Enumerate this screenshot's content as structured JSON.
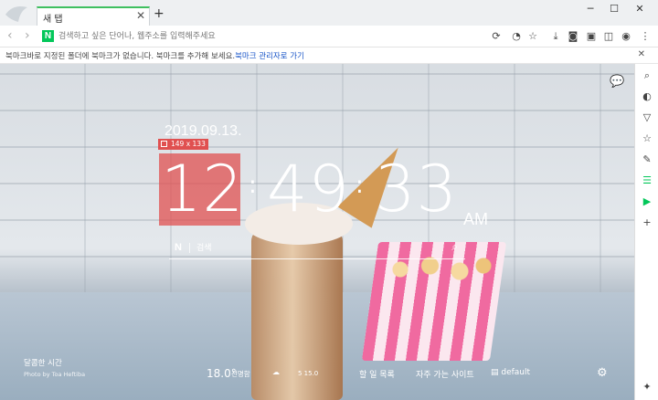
{
  "tab": {
    "title": "새 탭",
    "close": "✕",
    "new": "+"
  },
  "window": {
    "minimize": "─",
    "maximize": "☐",
    "close": "✕"
  },
  "toolbar": {
    "back": "‹",
    "forward": "›",
    "site_badge": "N",
    "address_placeholder": "검색하고 싶은 단어나, 웹주소를 입력해주세요"
  },
  "bookmark_bar": {
    "message": "북마크바로 지정된 폴더에 북마크가 없습니다. 북마크를 추가해 보세요.",
    "manage_link": "북마크 관리자로 가기",
    "close": "✕"
  },
  "overlay": {
    "selection_size": "149 x 133"
  },
  "clock": {
    "date": "2019.09.13.",
    "hour": "12",
    "minute": "49",
    "second": "33",
    "ampm": "AM"
  },
  "search": {
    "logo": "N",
    "placeholder": "검색"
  },
  "footer": {
    "tagline": "달콤한 시간",
    "credit": "Photo by Toa Heftiba",
    "temperature": "18.0°",
    "weather_desc": "선명함",
    "dust_value": "5 15.0",
    "links": [
      "할 일 목록",
      "자주 가는 사이트",
      "default"
    ]
  },
  "colors": {
    "accent": "#03c75a",
    "selection": "#e05050",
    "link": "#1a56c8"
  },
  "sidebar_icons": [
    "search-sidebar-icon",
    "whale-icon",
    "vivaldi-icon",
    "star-icon",
    "note-icon",
    "list-icon",
    "play-icon",
    "add-icon"
  ]
}
